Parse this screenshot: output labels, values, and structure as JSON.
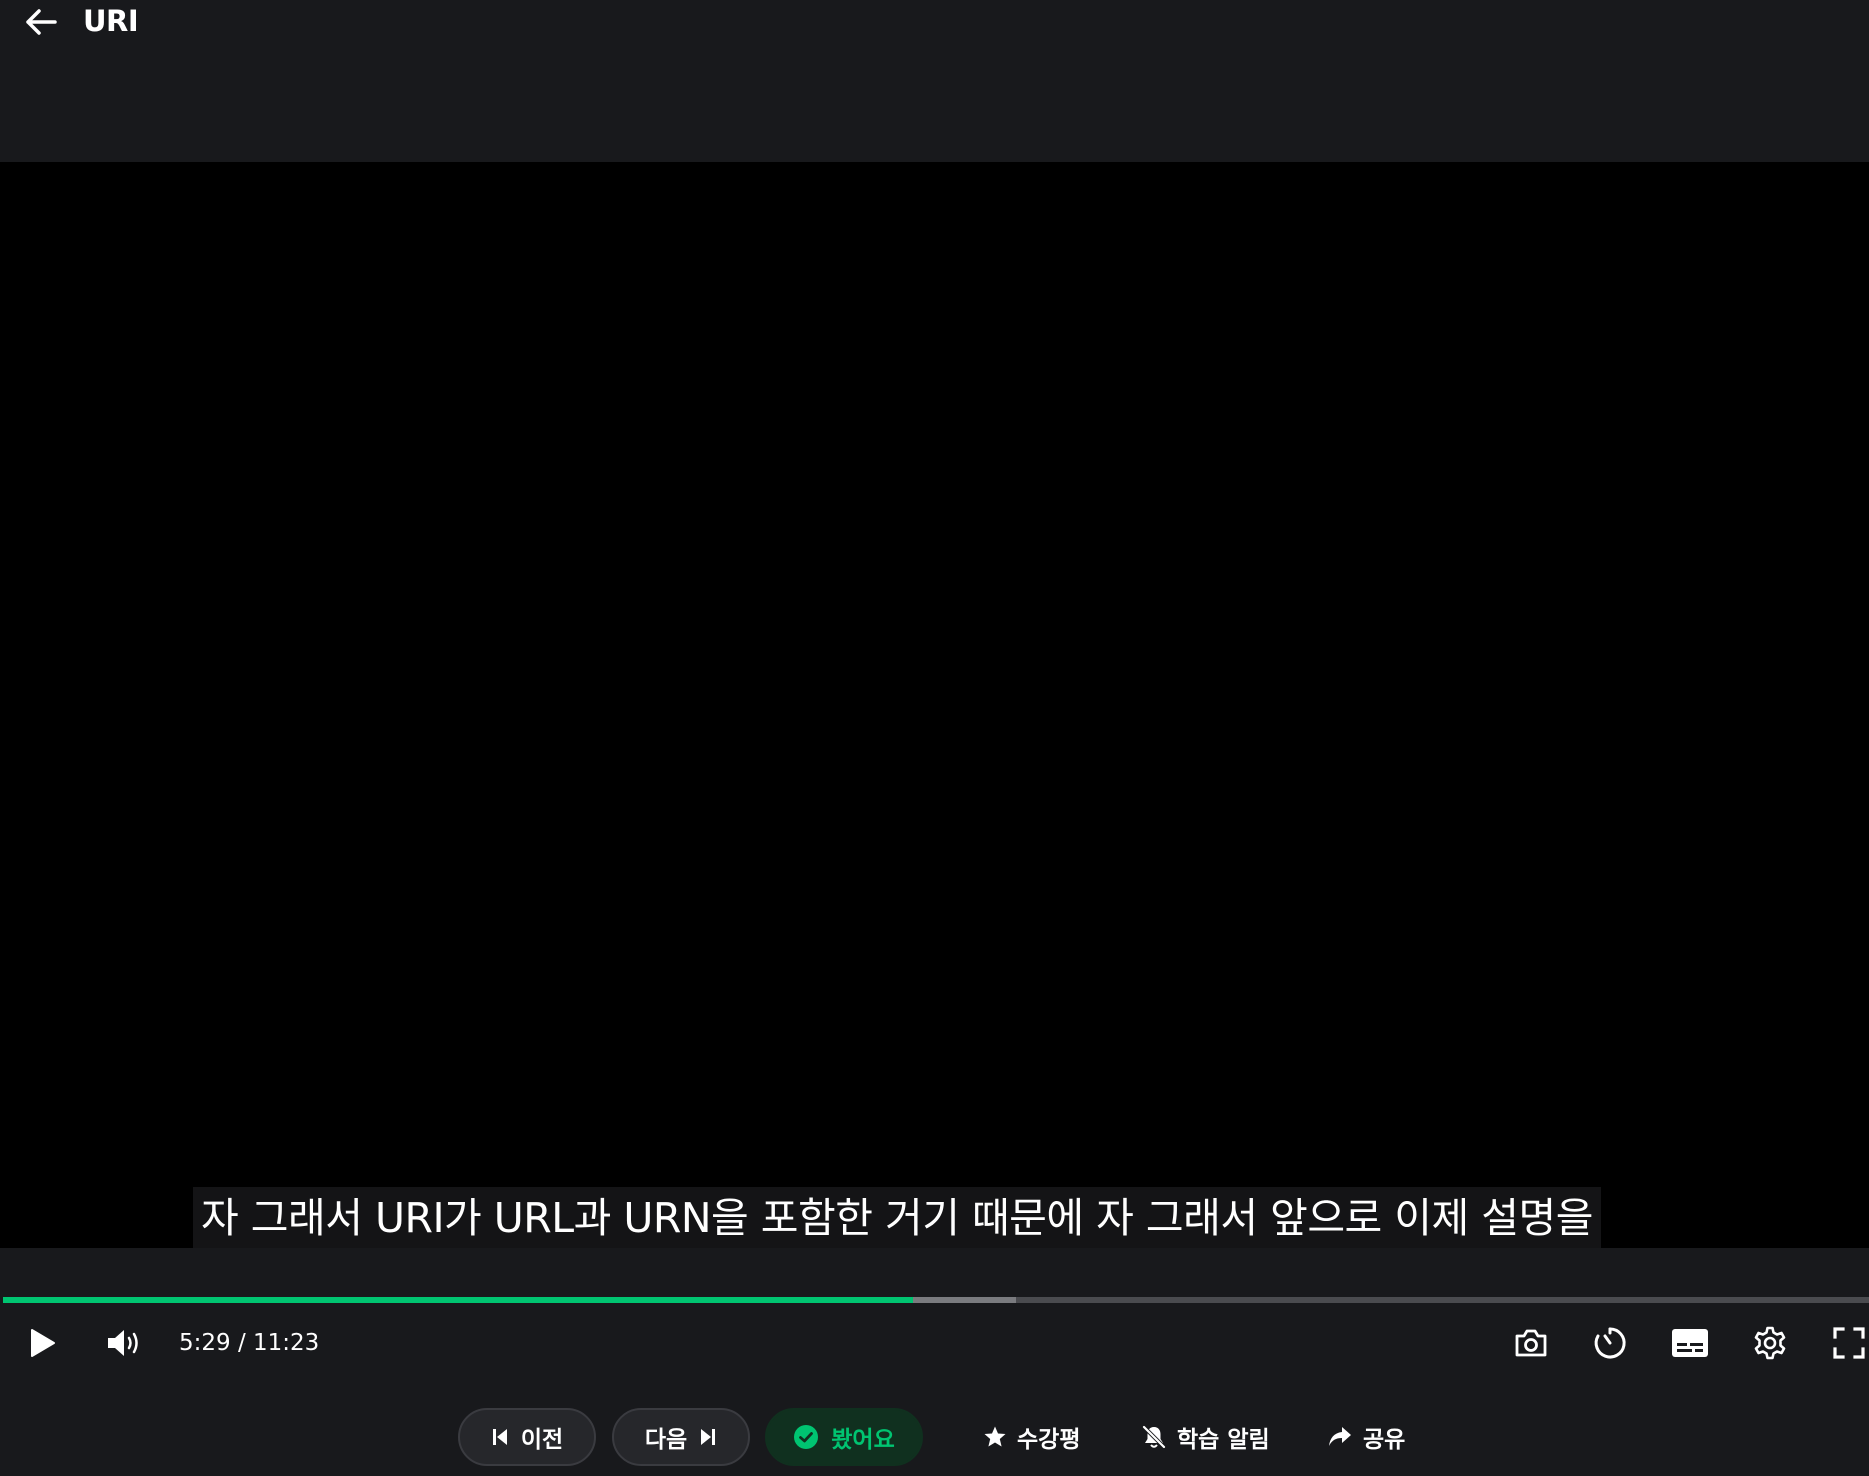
{
  "header": {
    "title": "URI",
    "back_icon": "arrow-left-icon"
  },
  "video": {
    "subtitle": "자 그래서 URI가 URL과 URN을 포함한 거기 때문에 자 그래서 앞으로 이제 설명을"
  },
  "player": {
    "current_time": "5:29",
    "duration": "11:23",
    "time_text": "5:29 / 11:23",
    "progress_fraction": 0.4875,
    "buffered_fraction": 0.543,
    "accent_color": "#00c471",
    "icons": {
      "play": "play-icon",
      "volume": "volume-icon",
      "screenshot": "camera-icon",
      "speed": "timer-icon",
      "captions": "subtitles-icon",
      "settings": "gear-icon",
      "fullscreen": "fullscreen-icon"
    }
  },
  "actions": {
    "prev_label": "이전",
    "next_label": "다음",
    "watched_label": "봤어요",
    "review_label": "수강평",
    "alarm_label": "학습 알림",
    "share_label": "공유"
  }
}
